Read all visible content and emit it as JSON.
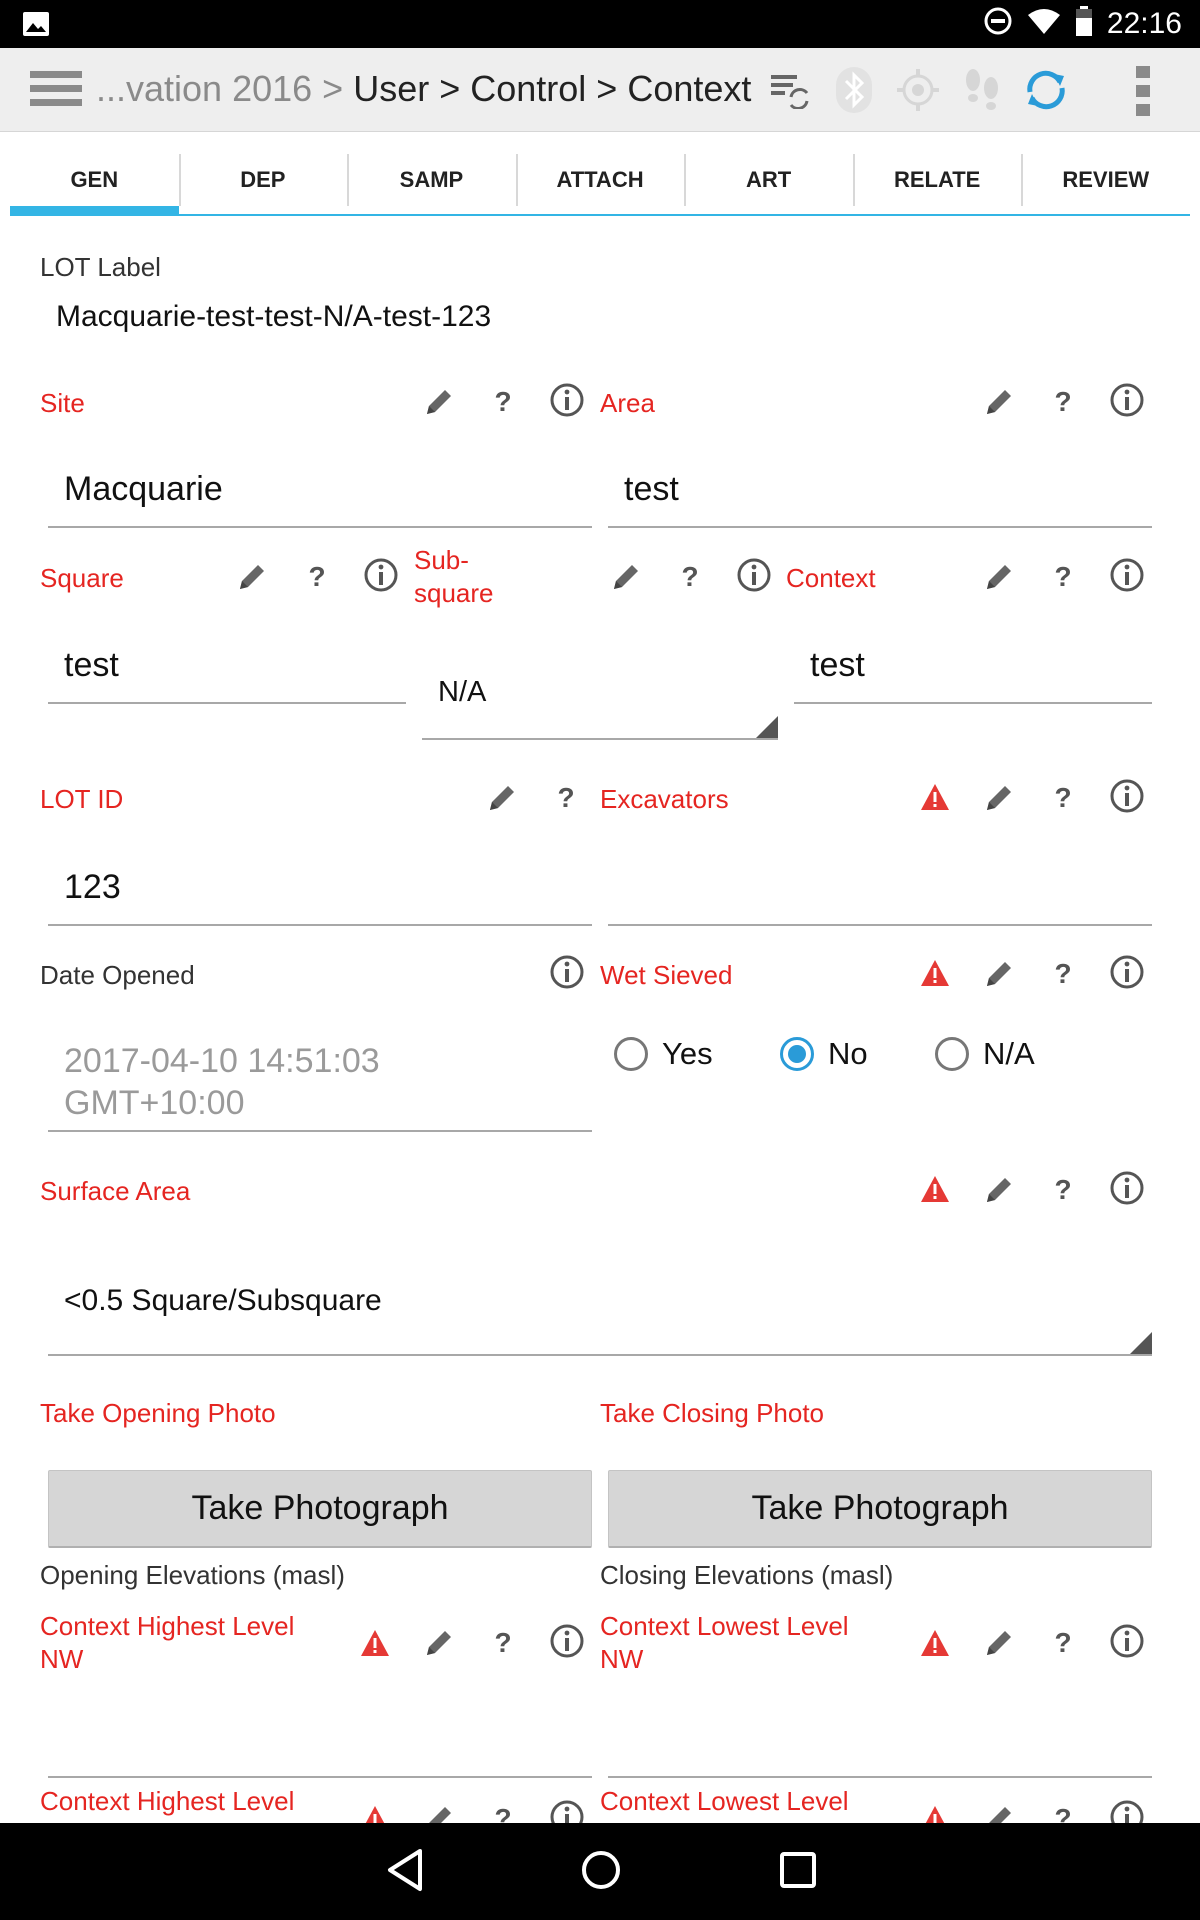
{
  "status_bar": {
    "time": "22:16",
    "icons": [
      "image-icon",
      "dnd-icon",
      "wifi-icon",
      "battery-icon"
    ]
  },
  "action_bar": {
    "breadcrumb_truncated": "...vation 2016 >",
    "breadcrumb_path": "User > Control > Context",
    "icons": [
      "sync-settings-icon",
      "bluetooth-icon",
      "gps-icon",
      "tracking-icon",
      "sync-icon",
      "overflow-menu-icon"
    ]
  },
  "tabs": [
    "GEN",
    "DEP",
    "SAMP",
    "ATTACH",
    "ART",
    "RELATE",
    "REVIEW"
  ],
  "form": {
    "lot_label": {
      "label": "LOT Label",
      "value": "Macquarie-test-test-N/A-test-123"
    },
    "site": {
      "label": "Site",
      "value": "Macquarie"
    },
    "area": {
      "label": "Area",
      "value": "test"
    },
    "square": {
      "label": "Square",
      "value": "test"
    },
    "subsquare": {
      "label": "Sub-\nsquare",
      "label_line1": "Sub-",
      "label_line2": "square",
      "value": "N/A"
    },
    "context": {
      "label": "Context",
      "value": "test"
    },
    "lot_id": {
      "label": "LOT ID",
      "value": "123"
    },
    "excavators": {
      "label": "Excavators",
      "value": ""
    },
    "date_opened": {
      "label": "Date Opened",
      "value_line1": "2017-04-10 14:51:03",
      "value_line2": "GMT+10:00"
    },
    "wet_sieved": {
      "label": "Wet Sieved",
      "options": [
        "Yes",
        "No",
        "N/A"
      ],
      "selected": "No"
    },
    "surface_area": {
      "label": "Surface Area",
      "value": "<0.5 Square/Subsquare"
    },
    "take_opening_photo": {
      "label": "Take Opening Photo",
      "button": "Take Photograph"
    },
    "take_closing_photo": {
      "label": "Take Closing Photo",
      "button": "Take Photograph"
    },
    "opening_elevations": "Opening Elevations (masl)",
    "closing_elevations": "Closing Elevations (masl)",
    "ctx_highest_nw": {
      "label_line1": "Context Highest Level",
      "label_line2": "NW"
    },
    "ctx_lowest_nw": {
      "label_line1": "Context Lowest Level",
      "label_line2": "NW"
    },
    "ctx_highest_next": {
      "label_line1": "Context Highest Level"
    },
    "ctx_lowest_next": {
      "label_line1": "Context Lowest Level"
    }
  },
  "colors": {
    "accent": "#33b5e5",
    "required_label": "#e52521",
    "warning": "#e53935",
    "radio_checked": "#2a9bd8"
  }
}
